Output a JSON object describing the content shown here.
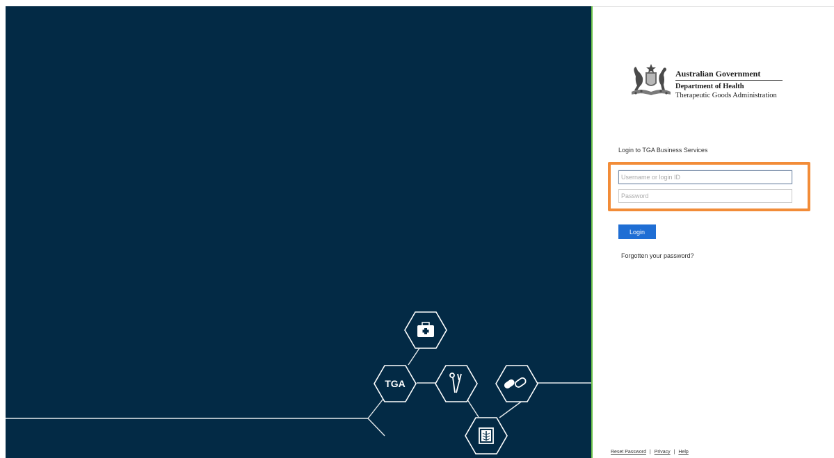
{
  "brand": {
    "title": "Australian Government",
    "department": "Department of Health",
    "agency": "Therapeutic Goods Administration"
  },
  "graphic": {
    "tga_label": "TGA",
    "icons": [
      "medical-kit-icon",
      "tga-hexagon",
      "surgical-tools-icon",
      "pills-icon",
      "xray-icon"
    ]
  },
  "login": {
    "heading": "Login to TGA Business Services",
    "username_placeholder": "Username or login ID",
    "password_placeholder": "Password",
    "button_label": "Login",
    "forgot_label": "Forgotten your password?"
  },
  "footer": {
    "links": [
      "Reset Password",
      "Privacy",
      "Help"
    ],
    "separator": "|"
  },
  "colors": {
    "left_panel": "#032a45",
    "divider": "#6cc24a",
    "highlight": "#f28c38",
    "button": "#1f6ed4"
  }
}
